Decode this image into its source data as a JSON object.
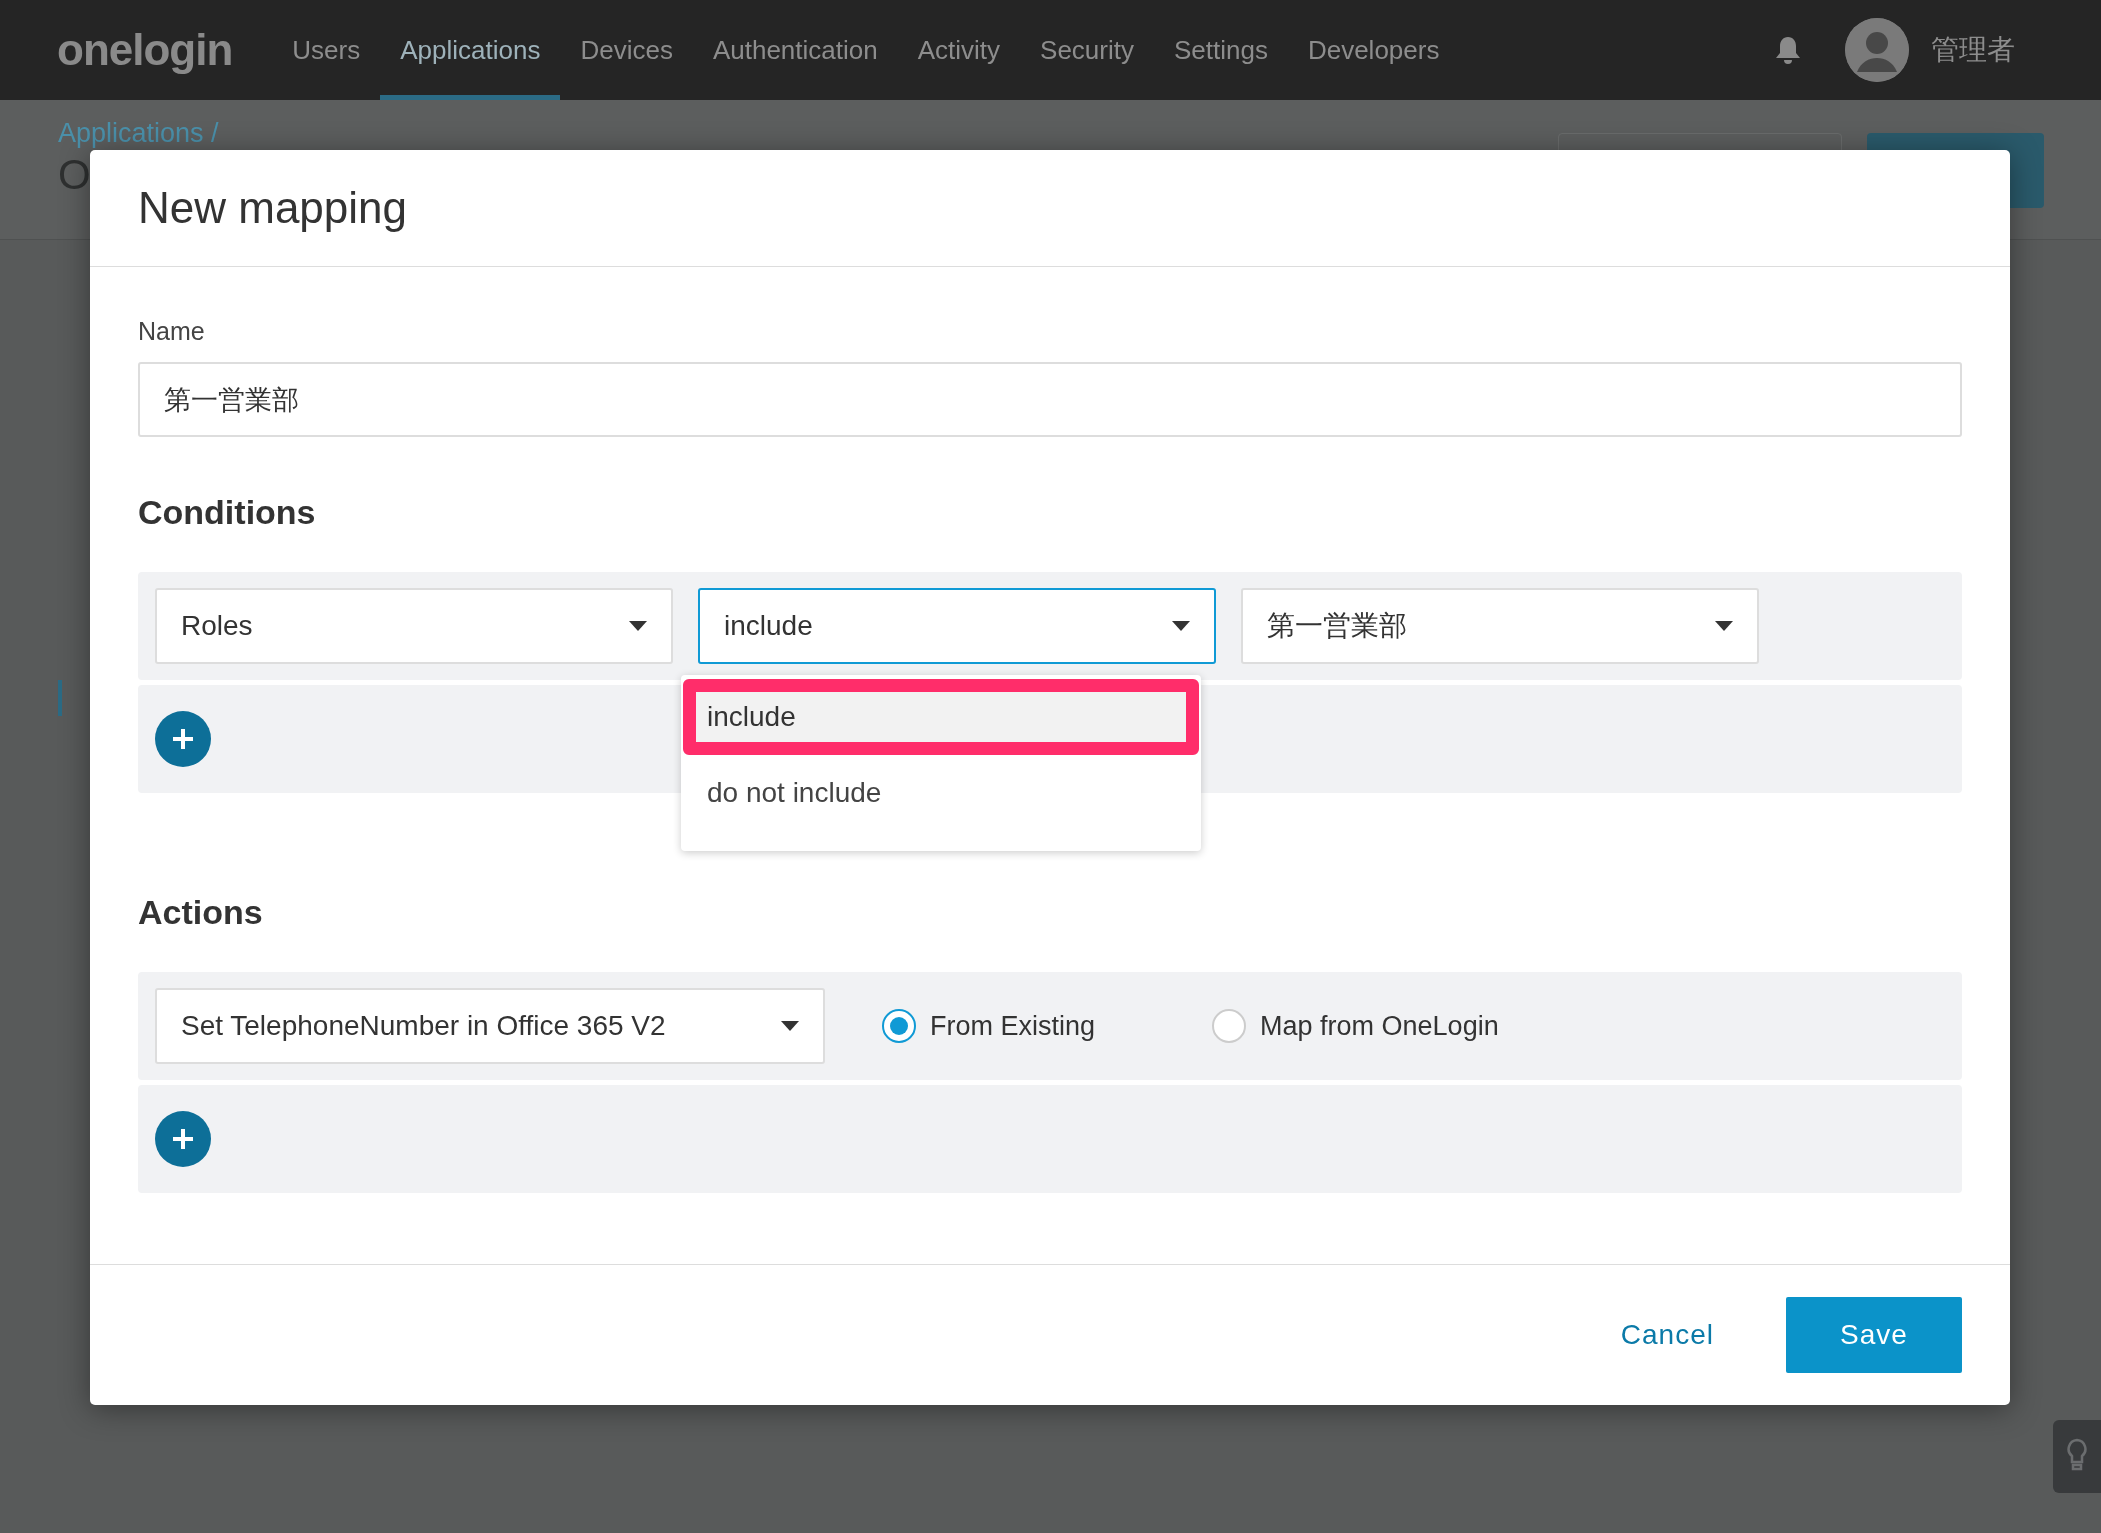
{
  "nav": {
    "logo": "onelogin",
    "items": [
      {
        "label": "Users",
        "selected": false
      },
      {
        "label": "Applications",
        "selected": true
      },
      {
        "label": "Devices",
        "selected": false
      },
      {
        "label": "Authentication",
        "selected": false
      },
      {
        "label": "Activity",
        "selected": false
      },
      {
        "label": "Security",
        "selected": false
      },
      {
        "label": "Settings",
        "selected": false
      },
      {
        "label": "Developers",
        "selected": false
      }
    ],
    "user": "管理者"
  },
  "background": {
    "breadcrumb": "Applications /",
    "title": "O"
  },
  "dialog": {
    "title": "New mapping",
    "name_label": "Name",
    "name_value": "第一営業部",
    "conditions": {
      "heading": "Conditions",
      "rows": [
        {
          "field": "Roles",
          "operator": "include",
          "value": "第一営業部",
          "operator_open": true
        }
      ],
      "dropdown": [
        {
          "label": "include",
          "selected": true,
          "highlighted": true
        },
        {
          "label": "do not include",
          "selected": false,
          "highlighted": false
        }
      ]
    },
    "actions": {
      "heading": "Actions",
      "rows": [
        {
          "action": "Set TelephoneNumber in Office 365 V2",
          "options": [
            {
              "label": "From Existing",
              "selected": true
            },
            {
              "label": "Map from OneLogin",
              "selected": false
            }
          ]
        }
      ]
    },
    "cancel": "Cancel",
    "save": "Save"
  }
}
